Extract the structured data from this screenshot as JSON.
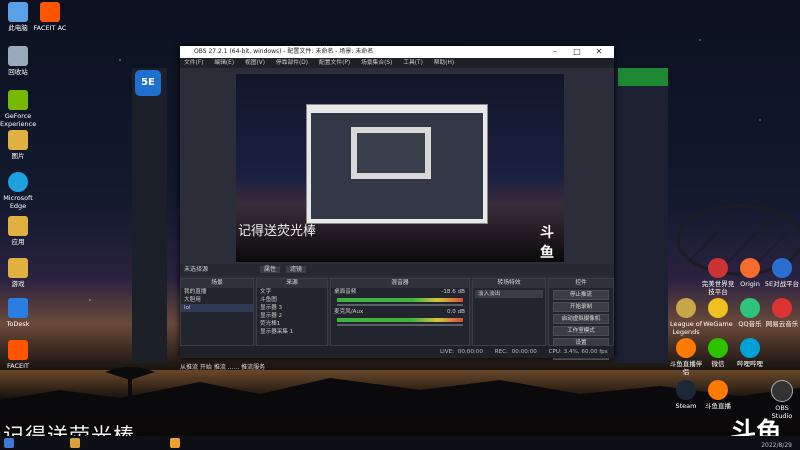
{
  "desktop": {
    "left_icons": [
      {
        "label": "此电脑",
        "icon": "computer-icon",
        "color": "#5aa0e6"
      },
      {
        "label": "回收站",
        "icon": "recycle-bin-icon",
        "color": "#9ab"
      },
      {
        "label": "GeForce Experience",
        "icon": "nvidia-icon",
        "color": "#76b900"
      },
      {
        "label": "图片",
        "icon": "pictures-folder-icon",
        "color": "#e0b040"
      },
      {
        "label": "Microsoft Edge",
        "icon": "edge-icon",
        "color": "#1fa0e0"
      },
      {
        "label": "应用",
        "icon": "apps-folder-icon",
        "color": "#e0b040"
      },
      {
        "label": "游戏",
        "icon": "games-folder-icon",
        "color": "#e0b040"
      },
      {
        "label": "ToDesk",
        "icon": "todesk-icon",
        "color": "#2a7de1"
      },
      {
        "label": "FACEIT",
        "icon": "faceit-icon",
        "color": "#ff5500"
      }
    ],
    "top_icon": {
      "label": "FACEIT AC",
      "icon": "faceit-ac-icon",
      "color": "#ff5500"
    },
    "right_icons": [
      {
        "label": "完美世界竞技平台",
        "icon": "perfect-world-icon",
        "color": "#c33"
      },
      {
        "label": "Origin",
        "icon": "origin-icon",
        "color": "#f56c2d"
      },
      {
        "label": "5E对战平台",
        "icon": "5e-icon",
        "color": "#2a6fd0"
      },
      {
        "label": "League of Legends",
        "icon": "lol-icon",
        "color": "#c8a64a"
      },
      {
        "label": "WeGame",
        "icon": "wegame-icon",
        "color": "#f0c020"
      },
      {
        "label": "QQ音乐",
        "icon": "qqmusic-icon",
        "color": "#31c27c"
      },
      {
        "label": "网易云音乐",
        "icon": "netease-music-icon",
        "color": "#d33"
      },
      {
        "label": "斗鱼直播伴侣",
        "icon": "douyu-partner-icon",
        "color": "#ff7a00"
      },
      {
        "label": "微信",
        "icon": "wechat-icon",
        "color": "#2dc100"
      },
      {
        "label": "哔哩哔哩",
        "icon": "bilibili-icon",
        "color": "#00a1d6"
      },
      {
        "label": "Steam",
        "icon": "steam-icon",
        "color": "#1b2838"
      },
      {
        "label": "斗鱼直播",
        "icon": "douyu-icon",
        "color": "#ff7a00"
      },
      {
        "label": "OBS Studio",
        "icon": "obs-icon",
        "color": "#333"
      }
    ]
  },
  "overlay": {
    "caption": "记得送荧光棒",
    "brand": "斗鱼",
    "date": "2022/8/29"
  },
  "launcher": {
    "logo": "5E"
  },
  "obs": {
    "title": "OBS 27.2.1 (64-bit, windows) - 配置文件: 未命名 - 场景: 未命名",
    "menu": [
      "文件(F)",
      "编辑(E)",
      "视图(V)",
      "停靠部件(D)",
      "配置文件(P)",
      "场景集合(S)",
      "工具(T)",
      "帮助(H)"
    ],
    "preview_caption": "记得送荧光棒",
    "preview_brand": "斗鱼",
    "scene_bar_label": "未选择源",
    "scene_bar_props": "属性",
    "scene_bar_filters": "滤镜",
    "panels": {
      "scenes": {
        "title": "场景",
        "items": [
          "我的直播",
          "大胆用",
          "lol"
        ]
      },
      "sources": {
        "title": "来源",
        "items": [
          "文字",
          "斗鱼图",
          "显示器 3",
          "显示器 2",
          "荧光棒1",
          "显示器采集 1"
        ]
      },
      "mixer": {
        "title": "混音器",
        "tracks": [
          {
            "name": "桌面音频",
            "db": "-18.6 dB"
          },
          {
            "name": "麦克风/Aux",
            "db": "0.0 dB"
          }
        ]
      },
      "transitions": {
        "title": "转场特效",
        "value": "淡入淡出"
      },
      "controls": {
        "title": "控件",
        "buttons": [
          "停止推流",
          "开始录制",
          "启动虚拟摄像机",
          "工作室模式",
          "设置",
          "退出"
        ]
      }
    },
    "status": {
      "live_label": "LIVE:",
      "live_time": "00:00:00",
      "rec_label": "REC:",
      "rec_time": "00:00:00",
      "cpu": "CPU: 3.4%, 60.00 fps"
    },
    "notice": "从推流 开始 推流 ...... 推流服务"
  }
}
